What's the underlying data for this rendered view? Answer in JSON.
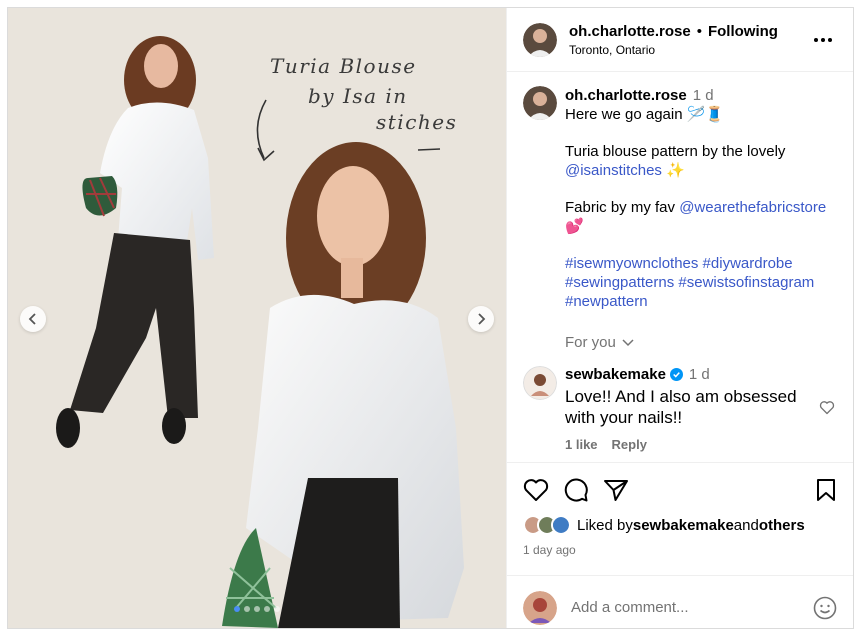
{
  "media": {
    "handwritten_lines": [
      "Turia Blouse",
      "by Isa in",
      "stiches"
    ],
    "dots_total": 5,
    "dots_active": 1
  },
  "header": {
    "username": "oh.charlotte.rose",
    "separator": "•",
    "follow_label": "Following",
    "location": "Toronto, Ontario"
  },
  "caption": {
    "username": "oh.charlotte.rose",
    "time": "1 d",
    "line1": "Here we go again 🪡🧵",
    "p2_text": "Turia blouse pattern by the lovely ",
    "p2_link": "@isainstitches",
    "p2_emoji": " ✨",
    "p3_text": "Fabric by my fav ",
    "p3_link": "@wearethefabricstore",
    "p3_emoji": "💕",
    "tags_line1": "#isewmyownclothes #diywardrobe",
    "tags_line2": "#sewingpatterns #sewistsofinstagram",
    "tags_line3": "#newpattern"
  },
  "for_you": "For you",
  "comment": {
    "username": "sewbakemake",
    "time": "1 d",
    "text": "Love!! And I also am obsessed with your nails!!",
    "likes": "1 like",
    "reply": "Reply"
  },
  "likes": {
    "prefix": "Liked by ",
    "user": "sewbakemake",
    "middle": " and ",
    "others": "others"
  },
  "date": "1 day ago",
  "add_comment": {
    "placeholder": "Add a comment..."
  },
  "colors": {
    "link": "#3a58c8",
    "muted": "#737373",
    "verified": "#0095f6",
    "paper": "#e9e4dc"
  }
}
